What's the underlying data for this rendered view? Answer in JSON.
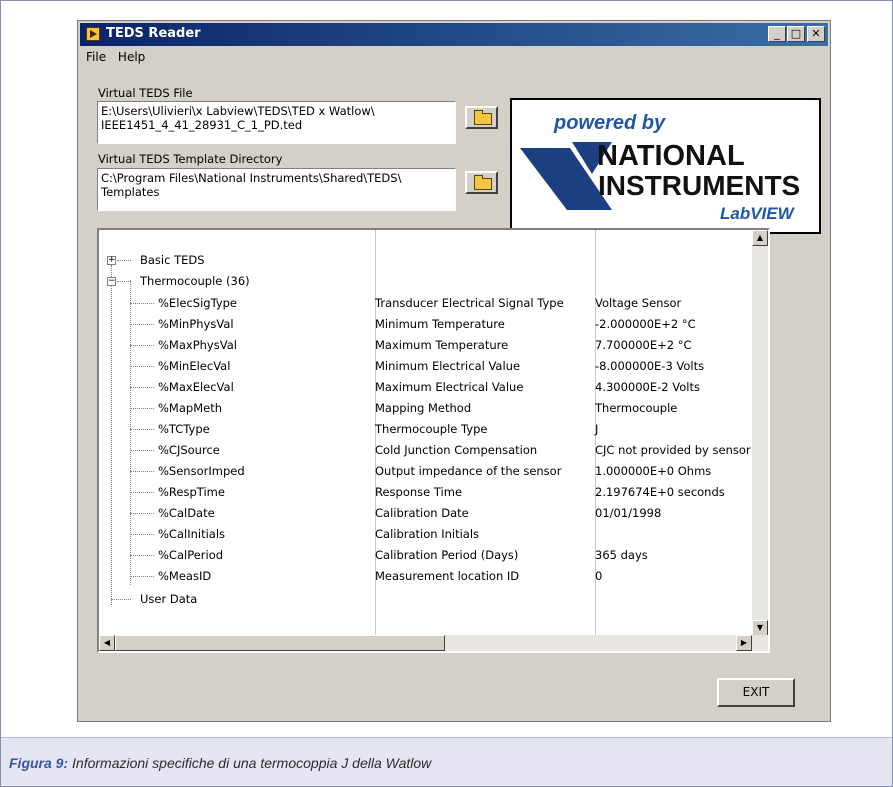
{
  "window": {
    "title": "TEDS Reader"
  },
  "menu": {
    "file": "File",
    "help": "Help"
  },
  "virtual_file": {
    "label": "Virtual TEDS File",
    "value": "E:\\Users\\Ulivieri\\x Labview\\TEDS\\TED x Watlow\\\nIEEE1451_4_41_28931_C_1_PD.ted"
  },
  "template_dir": {
    "label": "Virtual TEDS Template Directory",
    "value": "C:\\Program Files\\National Instruments\\Shared\\TEDS\\\nTemplates"
  },
  "logo": {
    "powered": "powered by",
    "line1": "NATIONAL",
    "line2": "INSTRUMENTS",
    "line3": "LabVIEW"
  },
  "tree": {
    "top_nodes": {
      "basic": "Basic TEDS",
      "thermo": "Thermocouple (36)",
      "user": "User Data"
    },
    "rows": [
      {
        "name": "%ElecSigType",
        "desc": "Transducer Electrical Signal Type",
        "value": "Voltage Sensor"
      },
      {
        "name": "%MinPhysVal",
        "desc": "Minimum Temperature",
        "value": "-2.000000E+2 °C"
      },
      {
        "name": "%MaxPhysVal",
        "desc": "Maximum Temperature",
        "value": "7.700000E+2 °C"
      },
      {
        "name": "%MinElecVal",
        "desc": "Minimum Electrical Value",
        "value": "-8.000000E-3 Volts"
      },
      {
        "name": "%MaxElecVal",
        "desc": "Maximum Electrical Value",
        "value": "4.300000E-2 Volts"
      },
      {
        "name": "%MapMeth",
        "desc": "Mapping Method",
        "value": "Thermocouple"
      },
      {
        "name": "%TCType",
        "desc": "Thermocouple Type",
        "value": "J"
      },
      {
        "name": "%CJSource",
        "desc": "Cold Junction Compensation",
        "value": "CJC not provided by sensor"
      },
      {
        "name": "%SensorImped",
        "desc": "Output impedance of the sensor",
        "value": "1.000000E+0 Ohms"
      },
      {
        "name": "%RespTime",
        "desc": "Response Time",
        "value": "2.197674E+0 seconds"
      },
      {
        "name": "%CalDate",
        "desc": "Calibration Date",
        "value": "01/01/1998"
      },
      {
        "name": "%CalInitials",
        "desc": "Calibration Initials",
        "value": ""
      },
      {
        "name": "%CalPeriod",
        "desc": "Calibration Period (Days)",
        "value": "365 days"
      },
      {
        "name": "%MeasID",
        "desc": "Measurement location ID",
        "value": "0"
      }
    ]
  },
  "exit_label": "EXIT",
  "caption": {
    "label": "Figura 9:",
    "text": "Informazioni specifiche di una termocoppia J della Watlow"
  }
}
